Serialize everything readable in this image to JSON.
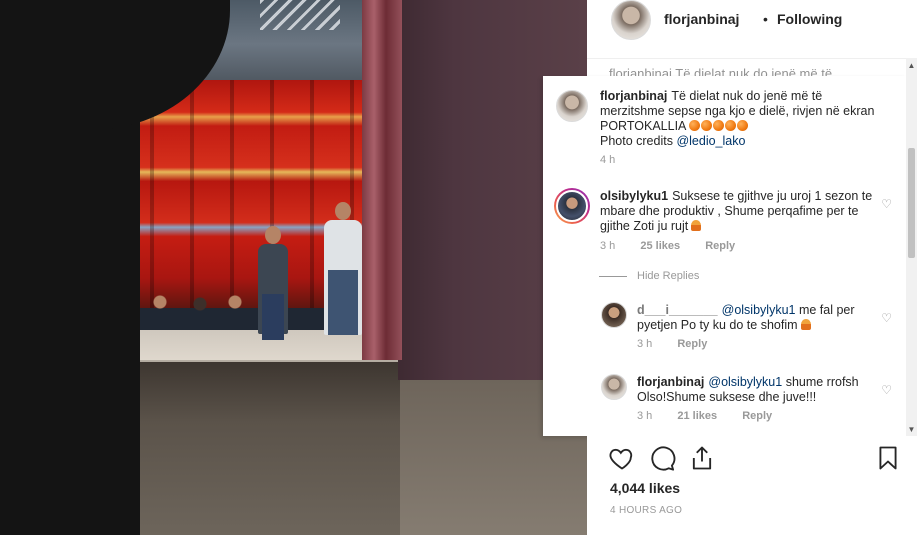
{
  "post": {
    "username": "florjanbinaj",
    "separator": "•",
    "follow_state": "Following",
    "obscured_text": "florjanbinaj Të dielat nuk do jenë më të merzitshme",
    "likes": "4,044 likes",
    "time_ago": "4 HOURS AGO"
  },
  "caption": {
    "username": "florjanbinaj",
    "text": "Të dielat nuk do jenë më të merzitshme sepse nga  kjo e dielë,  rivjen në ekran PORTOKALLIA",
    "credits_prefix": "Photo credits",
    "credits_mention": "@ledio_lako",
    "time": "4 h",
    "emoji": "🍊🍊🍊🍊🍊"
  },
  "comments": [
    {
      "username": "olsibylyku1",
      "text": "Suksese te gjithve ju uroj 1 sezon te mbare dhe produktiv , Shume perqafime per te gjithe Zoti ju rujt",
      "emoji": "🙏",
      "time": "3 h",
      "likes": "25 likes",
      "reply": "Reply"
    }
  ],
  "hide_replies": "Hide Replies",
  "replies": [
    {
      "username": "d___i_______",
      "mention": "@olsibylyku1",
      "text": "me fal per pyetjen Po ty ku do te shofim",
      "emoji": "🙏",
      "time": "3 h",
      "reply": "Reply"
    },
    {
      "username": "florjanbinaj",
      "mention": "@olsibylyku1",
      "text": "shume rrofsh Olso!Shume suksese dhe juve!!!",
      "time": "3 h",
      "likes": "21 likes",
      "reply": "Reply"
    }
  ],
  "icons": {
    "like": "heart-icon",
    "comment": "comment-bubble-icon",
    "share": "share-icon",
    "save": "bookmark-icon"
  },
  "colors": {
    "text": "#262626",
    "muted": "#999999",
    "mention": "#003569",
    "divider": "#efefef"
  }
}
